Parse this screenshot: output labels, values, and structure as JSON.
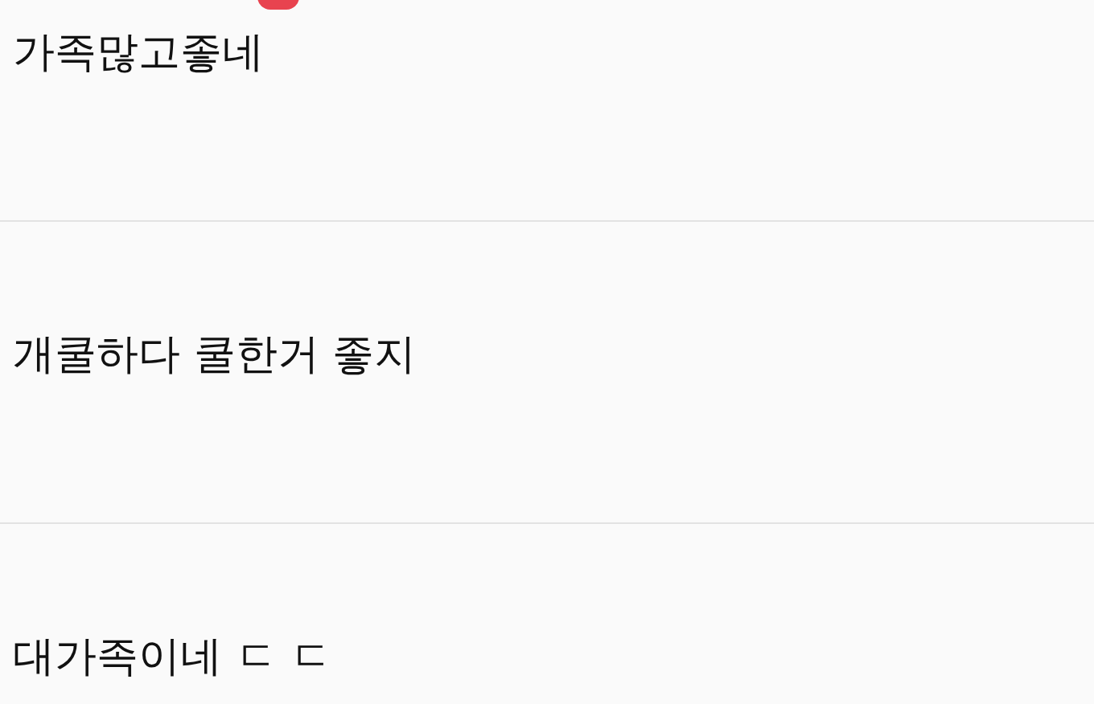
{
  "badge": true,
  "comments": [
    {
      "text": "가족많고좋네"
    },
    {
      "text": "개쿨하다 쿨한거 좋지"
    },
    {
      "text": "대가족이네 ㄷ ㄷ"
    }
  ]
}
